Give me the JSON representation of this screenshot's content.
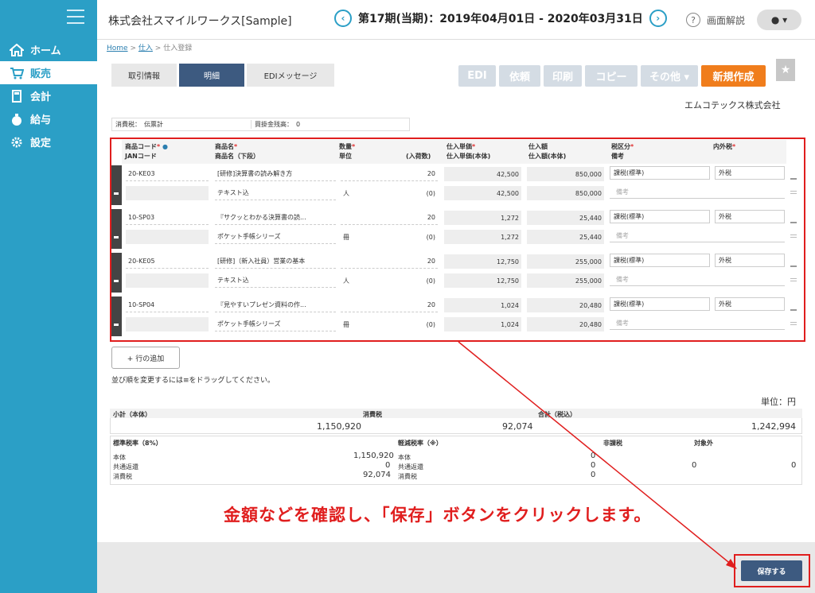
{
  "sidebar": {
    "items": [
      {
        "label": "ホーム",
        "icon": "home-icon"
      },
      {
        "label": "販売",
        "icon": "cart-icon"
      },
      {
        "label": "会計",
        "icon": "calculator-icon"
      },
      {
        "label": "給与",
        "icon": "money-bag-icon"
      },
      {
        "label": "設定",
        "icon": "gear-icon"
      }
    ]
  },
  "header": {
    "company": "株式会社スマイルワークス[Sample]",
    "period": "第17期(当期)：2019年04月01日 - 2020年03月31日",
    "help": "画面解説"
  },
  "breadcrumb": {
    "home": "Home",
    "purchase": "仕入",
    "current": "仕入登録",
    "sep": ">"
  },
  "tabs": [
    "取引情報",
    "明細",
    "EDIメッセージ"
  ],
  "toolbar": {
    "edi": "EDI",
    "request": "依頼",
    "print": "印刷",
    "copy": "コピー",
    "other": "その他 ▾",
    "new": "新規作成"
  },
  "supplier": "エムコテックス株式会社",
  "info": {
    "tax_label": "消費税：",
    "tax_value": "伝票計",
    "payable_label": "買掛金残高：",
    "payable_value": "0"
  },
  "columns": {
    "code": "商品コード",
    "jan": "JANコード",
    "name": "商品名",
    "name2": "商品名（下段）",
    "qty": "数量",
    "unit": "単位",
    "packs": "(入荷数)",
    "price": "仕入単価",
    "price_body": "仕入単価(本体)",
    "amount": "仕入額",
    "amount_body": "仕入額(本体)",
    "tax_class": "税区分",
    "remarks": "備考",
    "inout": "内外税"
  },
  "rows": [
    {
      "code": "20-KE03",
      "name": "[研修]決算書の読み解き方",
      "name2": "テキスト込",
      "qty": "20",
      "unit": "人",
      "packs": "(0)",
      "price": "42,500",
      "price_body": "42,500",
      "amount": "850,000",
      "amount_body": "850,000",
      "tax": "課税(標準)",
      "inout": "外税",
      "note": "備考"
    },
    {
      "code": "10-SP03",
      "name": "『サクッとわかる決算書の読...",
      "name2": "ポケット手帳シリーズ",
      "qty": "20",
      "unit": "冊",
      "packs": "(0)",
      "price": "1,272",
      "price_body": "1,272",
      "amount": "25,440",
      "amount_body": "25,440",
      "tax": "課税(標準)",
      "inout": "外税",
      "note": "備考"
    },
    {
      "code": "20-KE05",
      "name": "[研修]（新入社員）営業の基本",
      "name2": "テキスト込",
      "qty": "20",
      "unit": "人",
      "packs": "(0)",
      "price": "12,750",
      "price_body": "12,750",
      "amount": "255,000",
      "amount_body": "255,000",
      "tax": "課税(標準)",
      "inout": "外税",
      "note": "備考"
    },
    {
      "code": "10-SP04",
      "name": "『見やすいプレゼン資料の作...",
      "name2": "ポケット手帳シリーズ",
      "qty": "20",
      "unit": "冊",
      "packs": "(0)",
      "price": "1,024",
      "price_body": "1,024",
      "amount": "20,480",
      "amount_body": "20,480",
      "tax": "課税(標準)",
      "inout": "外税",
      "note": "備考"
    }
  ],
  "add_row": "+ 行の追加",
  "reorder_hint": "並び順を変更するには≡をドラッグしてください。",
  "unit_label": "単位：円",
  "totals": {
    "subtotal_label": "小計（本体）",
    "subtotal": "1,150,920",
    "tax_label": "消費税",
    "tax": "92,074",
    "total_label": "合計（税込）",
    "total": "1,242,994",
    "std_label": "標準税率（8%）",
    "reduced_label": "軽減税率（※）",
    "nontax_label": "非課税",
    "exempt_label": "対象外",
    "body_label": "本体",
    "refund_label": "共通返還",
    "ctax_label": "消費税",
    "std_body": "1,150,920",
    "std_refund": "0",
    "std_tax": "92,074",
    "red_body": "0",
    "red_refund": "0",
    "red_tax": "0",
    "nontax": "0",
    "exempt": "0"
  },
  "caption": "金額などを確認し、「保存」ボタンをクリックします。",
  "save": "保存する",
  "colors": {
    "sidebar": "#2b9fc6",
    "accent": "#f07d1c",
    "highlight": "#e01e1e"
  }
}
